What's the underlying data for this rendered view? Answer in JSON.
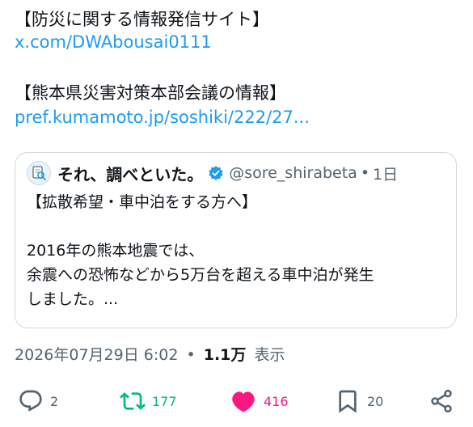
{
  "post": {
    "line1": "【防災に関する情報発信サイト】",
    "link1": "x.com/DWAbousai0111",
    "line2": "【熊本県災害対策本部会議の情報】",
    "link2": "pref.kumamoto.jp/soshiki/222/27..."
  },
  "quote": {
    "name": "それ、調べといた。",
    "handle": "@sore_shirabeta",
    "dot": "•",
    "time": "1日",
    "line1": "【拡散希望・車中泊をする方へ】",
    "line2": "2016年の熊本地震では、",
    "line3": "余震への恐怖などから5万台を超える車中泊が発生",
    "line4": "しました。..."
  },
  "meta": {
    "datetime": "2026年07月29日 6:02",
    "dot": "•",
    "views": "1.1万",
    "views_label": "表示"
  },
  "actions": {
    "reply_count": "2",
    "repost_count": "177",
    "like_count": "416",
    "bookmark_count": "20"
  },
  "colors": {
    "link": "#1d9bf0",
    "repost": "#00ba7c",
    "like": "#f91880",
    "muted": "#536471"
  }
}
